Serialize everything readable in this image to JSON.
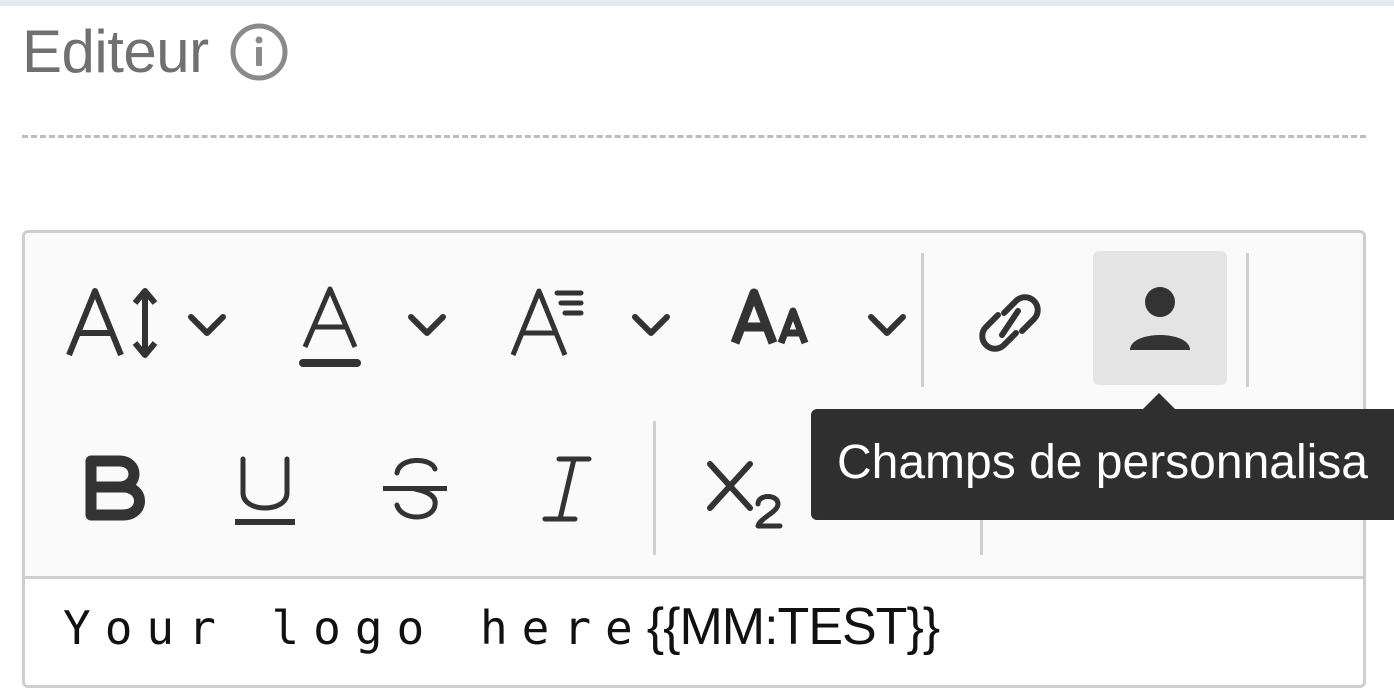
{
  "section": {
    "title": "Editeur",
    "info_icon": "info-circle-icon"
  },
  "toolbar": {
    "row1": [
      {
        "name": "font-size-dropdown",
        "icon": "font-size-icon"
      },
      {
        "name": "font-color-dropdown",
        "icon": "font-color-icon"
      },
      {
        "name": "line-height-dropdown",
        "icon": "line-height-icon"
      },
      {
        "name": "text-case-dropdown",
        "icon": "text-case-icon"
      },
      {
        "name": "link-button",
        "icon": "link-icon"
      },
      {
        "name": "personalization-fields-button",
        "icon": "person-icon",
        "active": true
      }
    ],
    "row2": [
      {
        "name": "bold-button",
        "icon": "bold-icon"
      },
      {
        "name": "underline-button",
        "icon": "underline-icon"
      },
      {
        "name": "strikethrough-button",
        "icon": "strikethrough-icon"
      },
      {
        "name": "italic-button",
        "icon": "italic-icon"
      },
      {
        "name": "subscript-button",
        "icon": "subscript-icon"
      }
    ]
  },
  "tooltip": {
    "text": "Champs de personnalisa"
  },
  "content": {
    "text_plain": "Your logo here",
    "text_token": "{{MM:TEST}}"
  },
  "colors": {
    "icon": "#333333",
    "tooltip_bg": "#2f2f2f",
    "active_bg": "#e4e4e4",
    "border": "#cfcfcf"
  }
}
